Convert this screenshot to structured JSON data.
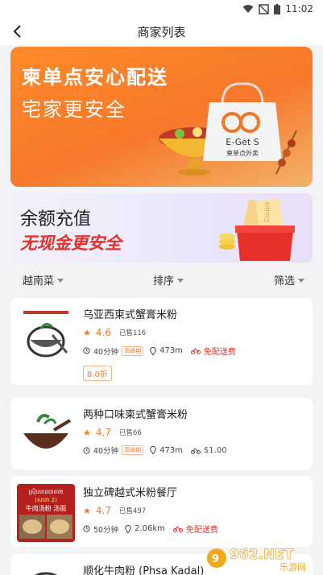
{
  "status_bar": {
    "time": "11:02"
  },
  "header": {
    "title": "商家列表"
  },
  "banners": {
    "delivery": {
      "line1": "柬单点安心配送",
      "line2": "宅家更安全",
      "brand_name": "E-Get S",
      "brand_sub": "柬单点外卖"
    },
    "balance": {
      "line1": "余额充值",
      "line2": "无现金更安全",
      "coupon_text": "Coupo"
    }
  },
  "filters": {
    "cuisine": "越南菜",
    "sort": "排序",
    "screen": "筛选"
  },
  "merchants": [
    {
      "name": "乌亚西柬式蟹膏米粉",
      "rating": "4.6",
      "sold": "已售116",
      "time": "40分钟",
      "peak": "高峰期",
      "distance": "473m",
      "fee": "免配送费",
      "fee_highlight": true,
      "discount": "8.0折"
    },
    {
      "name": "两种口味柬式蟹膏米粉",
      "rating": "4.7",
      "sold": "已售66",
      "time": "40分钟",
      "peak": "高峰期",
      "distance": "473m",
      "fee": "$1.00",
      "fee_highlight": false,
      "discount": ""
    },
    {
      "name": "独立碑越式米粉餐厅",
      "rating": "4.7",
      "sold": "已售497",
      "time": "50分钟",
      "peak": "",
      "distance": "2.06km",
      "fee": "免配送费",
      "fee_highlight": true,
      "discount": "",
      "thumb_text1": "ស្រ៊ិបមានជាតា២",
      "thumb_text2": "(សាខា 2)",
      "thumb_text3": "牛肉汤粉 汤面"
    },
    {
      "name": "顺化牛肉粉 (Phsa Kadal)"
    }
  ],
  "watermark": {
    "text": "962.NET",
    "sub": "乐游网"
  },
  "colors": {
    "accent": "#f7792b",
    "red": "#e6312b",
    "background": "#f3f3f5"
  }
}
